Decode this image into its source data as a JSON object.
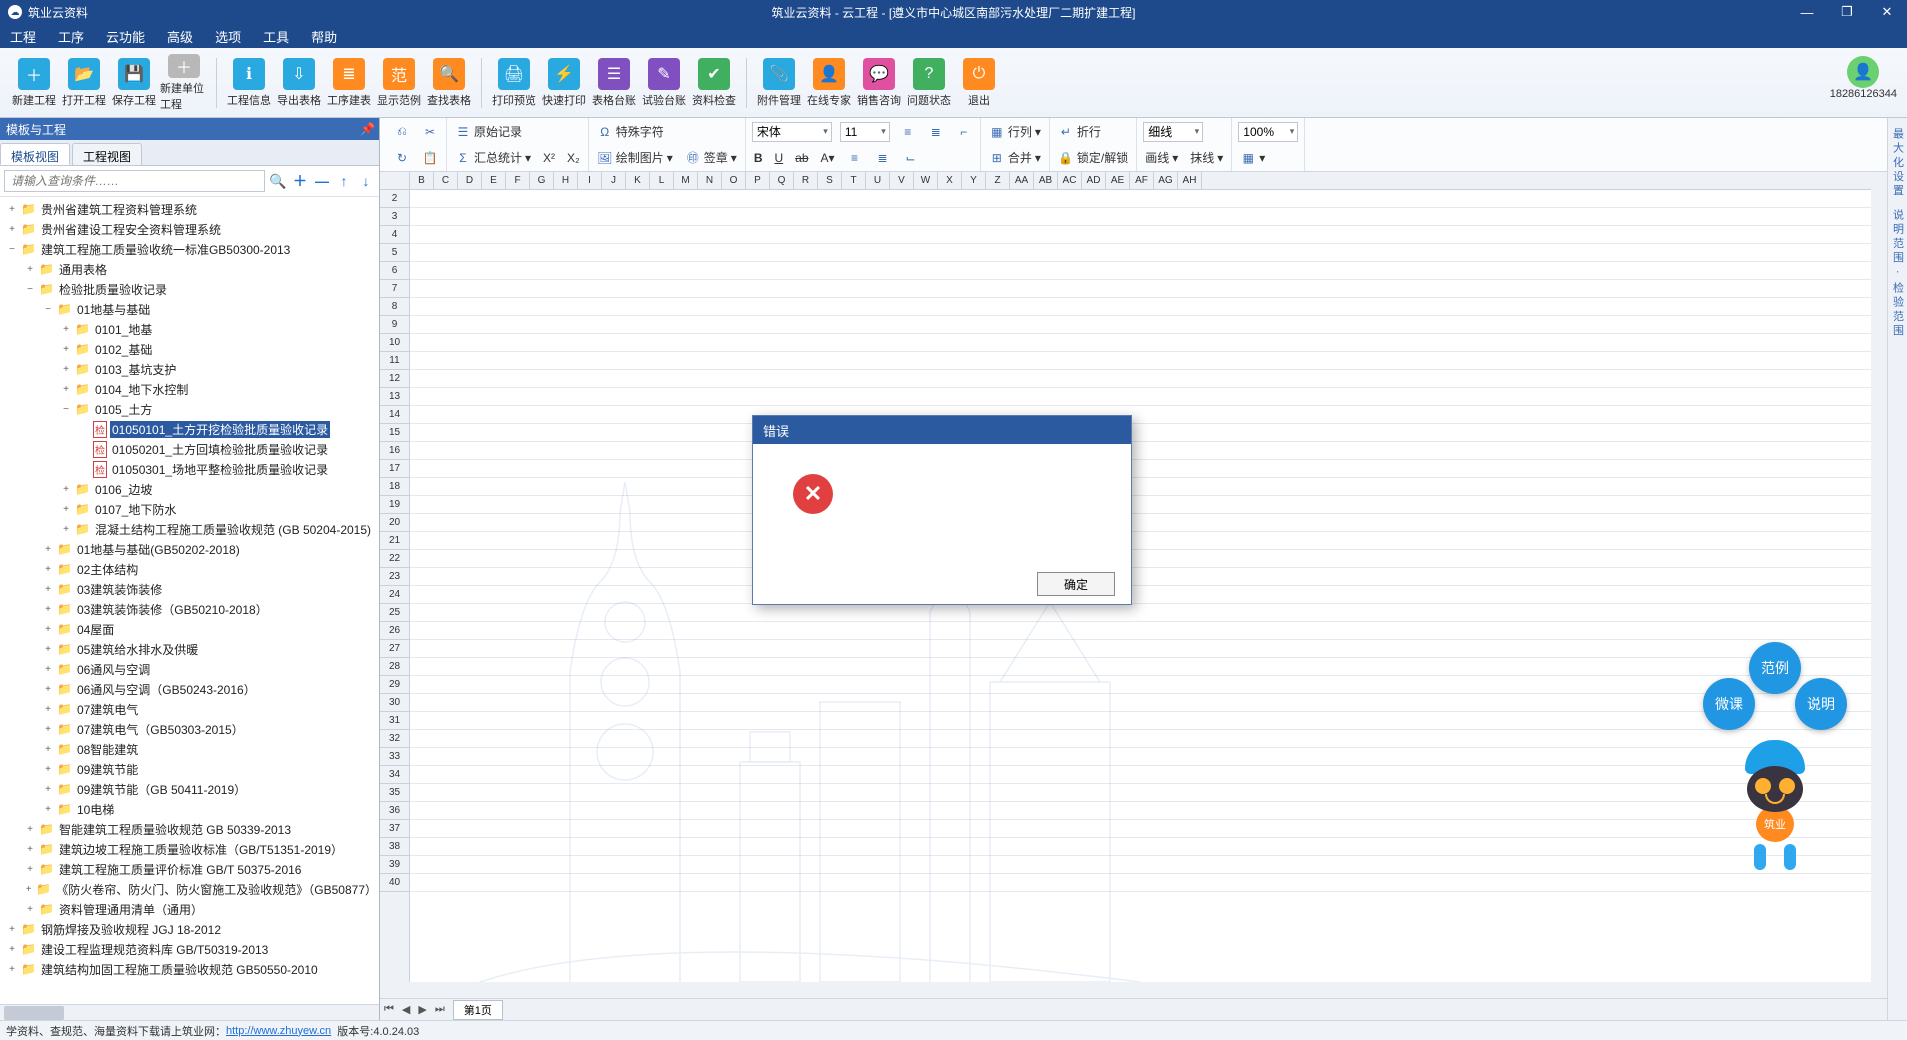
{
  "app": {
    "name": "筑业云资料",
    "documentTitle": "筑业云资料 - 云工程 - [遵义市中心城区南部污水处理厂二期扩建工程]"
  },
  "winControls": {
    "min": "—",
    "max": "❐",
    "close": "✕"
  },
  "menu": [
    "工程",
    "工序",
    "云功能",
    "高级",
    "选项",
    "工具",
    "帮助"
  ],
  "user": {
    "id": "18286126344"
  },
  "toolbarMain": [
    [
      {
        "label": "新建工程",
        "icon": "＋",
        "bg": "#2aa8e0"
      },
      {
        "label": "打开工程",
        "icon": "📂",
        "bg": "#2aa8e0"
      },
      {
        "label": "保存工程",
        "icon": "💾",
        "bg": "#2aa8e0"
      },
      {
        "label": "新建单位工程",
        "icon": "＋",
        "bg": "#b8b8b8"
      }
    ],
    [
      {
        "label": "工程信息",
        "icon": "ℹ",
        "bg": "#2aa8e0"
      },
      {
        "label": "导出表格",
        "icon": "⇩",
        "bg": "#2aa8e0"
      },
      {
        "label": "工序建表",
        "icon": "≣",
        "bg": "#ff8a20"
      },
      {
        "label": "显示范例",
        "icon": "范",
        "bg": "#ff8a20"
      },
      {
        "label": "查找表格",
        "icon": "🔍",
        "bg": "#ff8a20"
      }
    ],
    [
      {
        "label": "打印预览",
        "icon": "🖨",
        "bg": "#2aa8e0"
      },
      {
        "label": "快速打印",
        "icon": "⚡",
        "bg": "#2aa8e0"
      },
      {
        "label": "表格台账",
        "icon": "☰",
        "bg": "#8050c0"
      },
      {
        "label": "试验台账",
        "icon": "✎",
        "bg": "#8050c0"
      },
      {
        "label": "资料检查",
        "icon": "✔",
        "bg": "#40b060"
      }
    ],
    [
      {
        "label": "附件管理",
        "icon": "📎",
        "bg": "#2aa8e0"
      },
      {
        "label": "在线专家",
        "icon": "👤",
        "bg": "#ff8a20"
      },
      {
        "label": "销售咨询",
        "icon": "💬",
        "bg": "#e050a0"
      },
      {
        "label": "问题状态",
        "icon": "?",
        "bg": "#40b060"
      },
      {
        "label": "退出",
        "icon": "⏻",
        "bg": "#ff8a20"
      }
    ]
  ],
  "leftPanel": {
    "title": "模板与工程",
    "tabs": [
      {
        "label": "模板视图",
        "active": true
      },
      {
        "label": "工程视图",
        "active": false
      }
    ],
    "searchPlaceholder": "请输入查询条件……",
    "searchTools": [
      "🔍",
      "＋",
      "—",
      "↑",
      "↓"
    ]
  },
  "tree": [
    {
      "indent": 0,
      "toggle": "+",
      "icon": "folder",
      "label": "贵州省建筑工程资料管理系统"
    },
    {
      "indent": 0,
      "toggle": "+",
      "icon": "folder",
      "label": "贵州省建设工程安全资料管理系统"
    },
    {
      "indent": 0,
      "toggle": "−",
      "icon": "folder",
      "label": "建筑工程施工质量验收统一标准GB50300-2013"
    },
    {
      "indent": 1,
      "toggle": "+",
      "icon": "folder",
      "label": "通用表格"
    },
    {
      "indent": 1,
      "toggle": "−",
      "icon": "folder",
      "label": "检验批质量验收记录"
    },
    {
      "indent": 2,
      "toggle": "−",
      "icon": "folder",
      "label": "01地基与基础"
    },
    {
      "indent": 3,
      "toggle": "+",
      "icon": "folder",
      "label": "0101_地基"
    },
    {
      "indent": 3,
      "toggle": "+",
      "icon": "folder",
      "label": "0102_基础"
    },
    {
      "indent": 3,
      "toggle": "+",
      "icon": "folder",
      "label": "0103_基坑支护"
    },
    {
      "indent": 3,
      "toggle": "+",
      "icon": "folder",
      "label": "0104_地下水控制"
    },
    {
      "indent": 3,
      "toggle": "−",
      "icon": "folder",
      "label": "0105_土方"
    },
    {
      "indent": 4,
      "toggle": "",
      "icon": "doc",
      "label": "01050101_土方开挖检验批质量验收记录",
      "selected": true
    },
    {
      "indent": 4,
      "toggle": "",
      "icon": "doc",
      "label": "01050201_土方回填检验批质量验收记录"
    },
    {
      "indent": 4,
      "toggle": "",
      "icon": "doc",
      "label": "01050301_场地平整检验批质量验收记录"
    },
    {
      "indent": 3,
      "toggle": "+",
      "icon": "folder",
      "label": "0106_边坡"
    },
    {
      "indent": 3,
      "toggle": "+",
      "icon": "folder",
      "label": "0107_地下防水"
    },
    {
      "indent": 3,
      "toggle": "+",
      "icon": "folder",
      "label": "混凝土结构工程施工质量验收规范 (GB 50204-2015)"
    },
    {
      "indent": 2,
      "toggle": "+",
      "icon": "folder",
      "label": "01地基与基础(GB50202-2018)"
    },
    {
      "indent": 2,
      "toggle": "+",
      "icon": "folder",
      "label": "02主体结构"
    },
    {
      "indent": 2,
      "toggle": "+",
      "icon": "folder",
      "label": "03建筑装饰装修"
    },
    {
      "indent": 2,
      "toggle": "+",
      "icon": "folder",
      "label": "03建筑装饰装修（GB50210-2018）"
    },
    {
      "indent": 2,
      "toggle": "+",
      "icon": "folder",
      "label": "04屋面"
    },
    {
      "indent": 2,
      "toggle": "+",
      "icon": "folder",
      "label": "05建筑给水排水及供暖"
    },
    {
      "indent": 2,
      "toggle": "+",
      "icon": "folder",
      "label": "06通风与空调"
    },
    {
      "indent": 2,
      "toggle": "+",
      "icon": "folder",
      "label": "06通风与空调（GB50243-2016）"
    },
    {
      "indent": 2,
      "toggle": "+",
      "icon": "folder",
      "label": "07建筑电气"
    },
    {
      "indent": 2,
      "toggle": "+",
      "icon": "folder",
      "label": "07建筑电气（GB50303-2015）"
    },
    {
      "indent": 2,
      "toggle": "+",
      "icon": "folder",
      "label": "08智能建筑"
    },
    {
      "indent": 2,
      "toggle": "+",
      "icon": "folder",
      "label": "09建筑节能"
    },
    {
      "indent": 2,
      "toggle": "+",
      "icon": "folder",
      "label": "09建筑节能（GB 50411-2019）"
    },
    {
      "indent": 2,
      "toggle": "+",
      "icon": "folder",
      "label": "10电梯"
    },
    {
      "indent": 1,
      "toggle": "+",
      "icon": "folder",
      "label": "智能建筑工程质量验收规范 GB 50339-2013"
    },
    {
      "indent": 1,
      "toggle": "+",
      "icon": "folder",
      "label": "建筑边坡工程施工质量验收标准（GB/T51351-2019）"
    },
    {
      "indent": 1,
      "toggle": "+",
      "icon": "folder",
      "label": "建筑工程施工质量评价标准 GB/T 50375-2016"
    },
    {
      "indent": 1,
      "toggle": "+",
      "icon": "folder",
      "label": "《防火卷帘、防火门、防火窗施工及验收规范》（GB50877）"
    },
    {
      "indent": 1,
      "toggle": "+",
      "icon": "folder",
      "label": "资料管理通用清单（通用）"
    },
    {
      "indent": 0,
      "toggle": "+",
      "icon": "folder",
      "label": "钢筋焊接及验收规程 JGJ 18-2012"
    },
    {
      "indent": 0,
      "toggle": "+",
      "icon": "folder",
      "label": "建设工程监理规范资料库 GB/T50319-2013"
    },
    {
      "indent": 0,
      "toggle": "+",
      "icon": "folder",
      "label": "建筑结构加固工程施工质量验收规范 GB50550-2010"
    }
  ],
  "ribbon2": {
    "r1c1a": "⎌",
    "r1c1b": "✂",
    "r1c2a": "原始记录",
    "r1c2b": "汇总统计",
    "r1c3a": "特殊字符",
    "r1c3b": "绘制图片",
    "r1c3c": "签章",
    "font": "宋体",
    "size": "11",
    "row4a": "行列",
    "row4b": "合并",
    "row5a": "折行",
    "row5b": "锁定/解锁",
    "line": "细线",
    "lineStyle": "画线",
    "dash": "抹线",
    "zoom": "100%"
  },
  "columns": [
    "B",
    "C",
    "D",
    "E",
    "F",
    "G",
    "H",
    "I",
    "J",
    "K",
    "L",
    "M",
    "N",
    "O",
    "P",
    "Q",
    "R",
    "S",
    "T",
    "U",
    "V",
    "W",
    "X",
    "Y",
    "Z",
    "AA",
    "AB",
    "AC",
    "AD",
    "AE",
    "AF",
    "AG",
    "AH"
  ],
  "rowStart": 2,
  "rowEnd": 40,
  "sheetTab": "第1页",
  "dialog": {
    "title": "错误",
    "ok": "确定"
  },
  "bubbles": {
    "top": "范例",
    "left": "微课",
    "right": "说明"
  },
  "mascotBadge": "筑业",
  "rightRail": [
    "最 大 化 设 置",
    "",
    "说 明 范 围",
    "·",
    "检 验 范 围"
  ],
  "status": {
    "prefix": "学资料、查规范、海量资料下载请上筑业网：",
    "url": "http://www.zhuyew.cn",
    "version": "版本号:4.0.24.03"
  }
}
